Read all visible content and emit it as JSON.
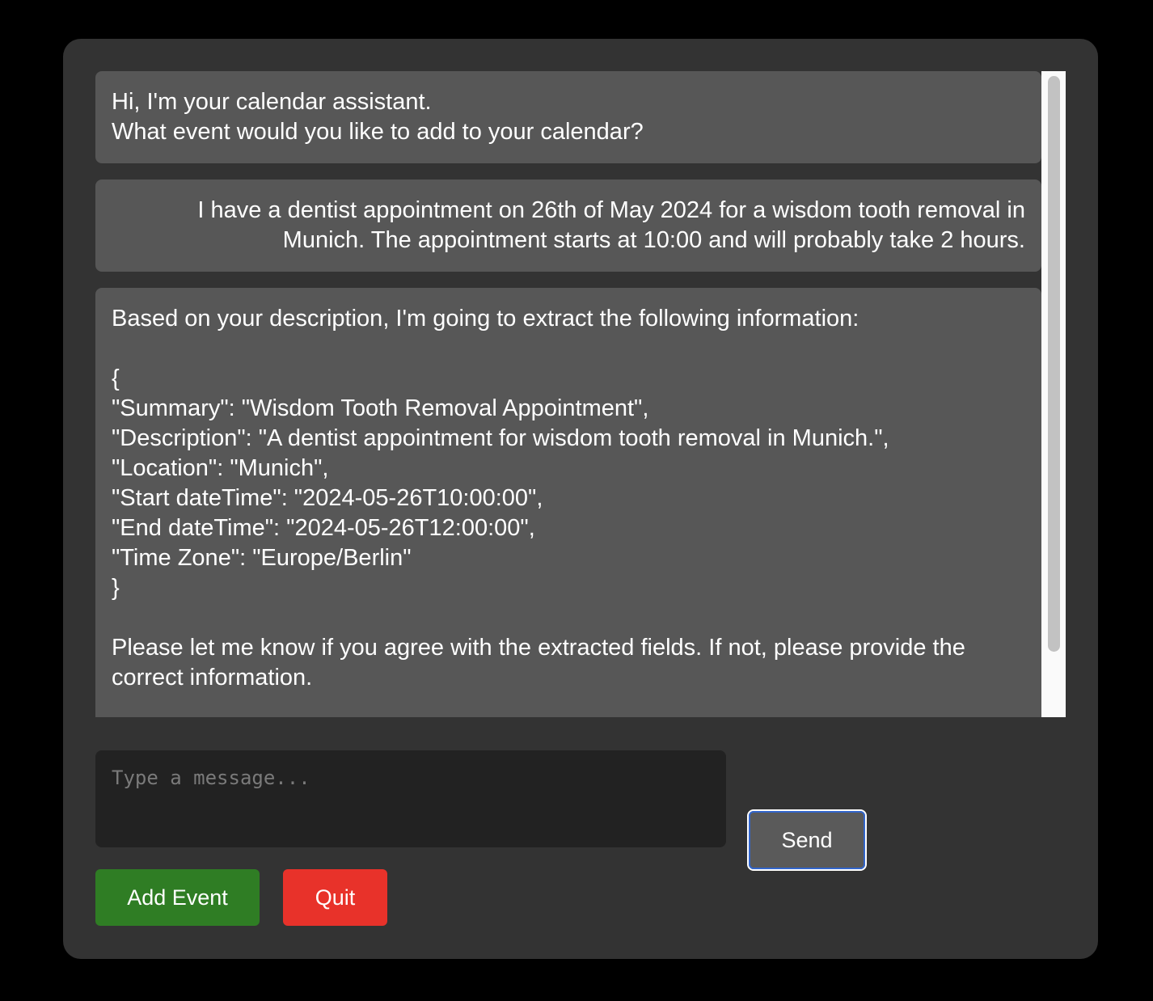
{
  "chat": {
    "messages": [
      {
        "role": "assistant",
        "text": "Hi, I'm your calendar assistant.\nWhat event would you like to add to your calendar?"
      },
      {
        "role": "user",
        "text": "I have a dentist appointment on 26th of May 2024 for a wisdom tooth removal in Munich. The appointment starts at 10:00 and will probably take 2 hours."
      },
      {
        "role": "assistant",
        "text": "Based on your description, I'm going to extract the following information:\n\n{\n\"Summary\": \"Wisdom Tooth Removal Appointment\",\n\"Description\": \"A dentist appointment for wisdom tooth removal in Munich.\",\n\"Location\": \"Munich\",\n\"Start dateTime\": \"2024-05-26T10:00:00\",\n\"End dateTime\": \"2024-05-26T12:00:00\",\n\"Time Zone\": \"Europe/Berlin\"\n}\n\nPlease let me know if you agree with the extracted fields. If not, please provide the correct information."
      }
    ]
  },
  "input": {
    "value": "",
    "placeholder": "Type a message..."
  },
  "buttons": {
    "send_label": "Send",
    "add_event_label": "Add Event",
    "quit_label": "Quit"
  },
  "colors": {
    "panel_background": "#333333",
    "bubble_background": "#575757",
    "input_background": "#222222",
    "add_event": "#2f7d24",
    "quit": "#e8322a",
    "send": "#5a5a5a",
    "focus_ring": "#3366cc"
  }
}
